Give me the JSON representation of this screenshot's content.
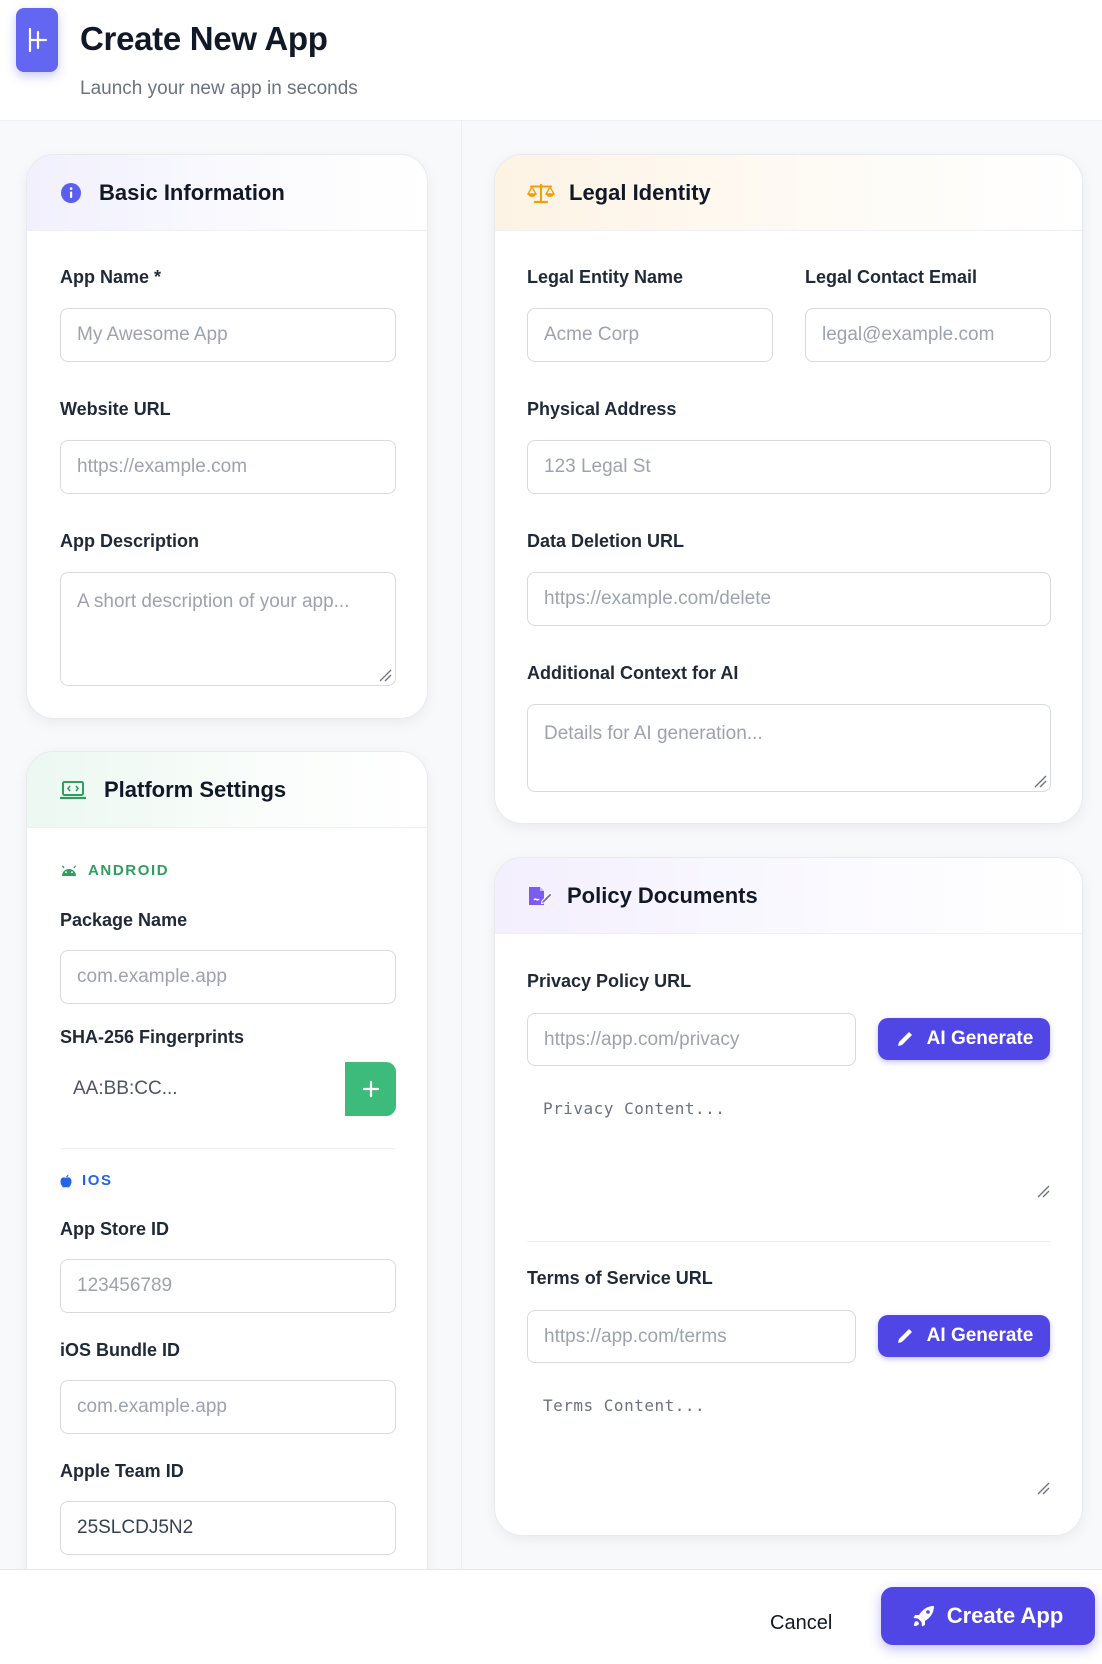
{
  "header": {
    "title": "Create New App",
    "subtitle": "Launch your new app in seconds"
  },
  "basic": {
    "title": "Basic Information",
    "app_name_label": "App Name *",
    "app_name_placeholder": "My Awesome App",
    "website_label": "Website URL",
    "website_placeholder": "https://example.com",
    "description_label": "App Description",
    "description_placeholder": "A short description of your app..."
  },
  "platform": {
    "title": "Platform Settings",
    "android_tag": "ANDROID",
    "package_label": "Package Name",
    "package_placeholder": "com.example.app",
    "sha_label": "SHA-256 Fingerprints",
    "sha_placeholder": "AA:BB:CC...",
    "ios_tag": "IOS",
    "app_store_label": "App Store ID",
    "app_store_placeholder": "123456789",
    "bundle_label": "iOS Bundle ID",
    "bundle_placeholder": "com.example.app",
    "team_label": "Apple Team ID",
    "team_value": "25SLCDJ5N2"
  },
  "legal": {
    "title": "Legal Identity",
    "entity_label": "Legal Entity Name",
    "entity_placeholder": "Acme Corp",
    "email_label": "Legal Contact Email",
    "email_placeholder": "legal@example.com",
    "address_label": "Physical Address",
    "address_placeholder": "123 Legal St",
    "deletion_label": "Data Deletion URL",
    "deletion_placeholder": "https://example.com/delete",
    "context_label": "Additional Context for AI",
    "context_placeholder": "Details for AI generation..."
  },
  "policy": {
    "title": "Policy Documents",
    "privacy_label": "Privacy Policy URL",
    "privacy_placeholder": "https://app.com/privacy",
    "privacy_content_placeholder": "Privacy Content...",
    "terms_label": "Terms of Service URL",
    "terms_placeholder": "https://app.com/terms",
    "terms_content_placeholder": "Terms Content...",
    "ai_generate_label": "AI Generate"
  },
  "footer": {
    "cancel_label": "Cancel",
    "create_label": "Create App"
  },
  "colors": {
    "accent": "#4f46e5",
    "android_green": "#2f9e5f",
    "ios_blue": "#2563eb",
    "add_button": "#3dbb7a",
    "legal_orange": "#f59e0b"
  }
}
